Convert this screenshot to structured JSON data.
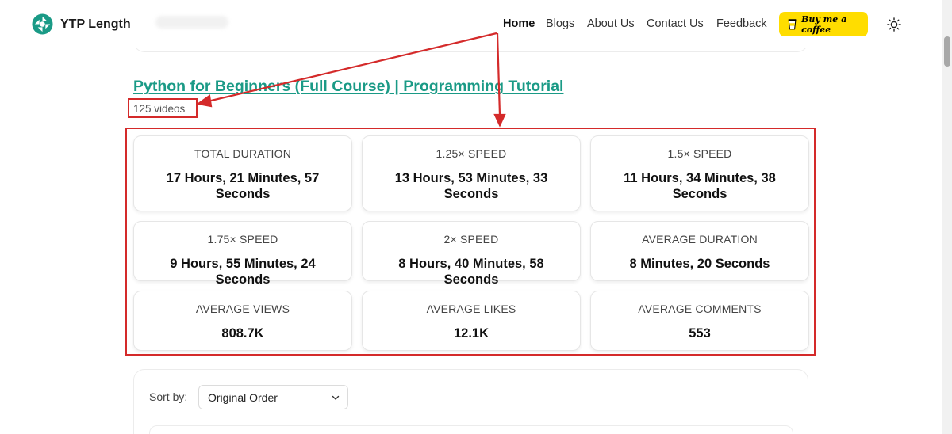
{
  "header": {
    "brand": "YTP Length",
    "nav": [
      "Home",
      "Blogs",
      "About Us",
      "Contact Us",
      "Feedback"
    ],
    "active": "Home",
    "coffee_label": "Buy me a coffee",
    "theme_icon": "sun-icon",
    "colors": {
      "brand": "#1a9a86",
      "coffee": "#ffdd00",
      "highlight": "#d42a2a"
    }
  },
  "playlist": {
    "title": "Python for Beginners (Full Course) | Programming Tutorial",
    "video_count": "125 videos"
  },
  "stats": [
    {
      "label": "TOTAL DURATION",
      "value": "17 Hours, 21 Minutes, 57 Seconds"
    },
    {
      "label": "1.25× SPEED",
      "value": "13 Hours, 53 Minutes, 33 Seconds"
    },
    {
      "label": "1.5× SPEED",
      "value": "11 Hours, 34 Minutes, 38 Seconds"
    },
    {
      "label": "1.75× SPEED",
      "value": "9 Hours, 55 Minutes, 24 Seconds"
    },
    {
      "label": "2× SPEED",
      "value": "8 Hours, 40 Minutes, 58 Seconds"
    },
    {
      "label": "AVERAGE DURATION",
      "value": "8 Minutes, 20 Seconds"
    },
    {
      "label": "AVERAGE VIEWS",
      "value": "808.7K"
    },
    {
      "label": "AVERAGE LIKES",
      "value": "12.1K"
    },
    {
      "label": "AVERAGE COMMENTS",
      "value": "553"
    }
  ],
  "sort": {
    "label": "Sort by:",
    "selected": "Original Order"
  }
}
